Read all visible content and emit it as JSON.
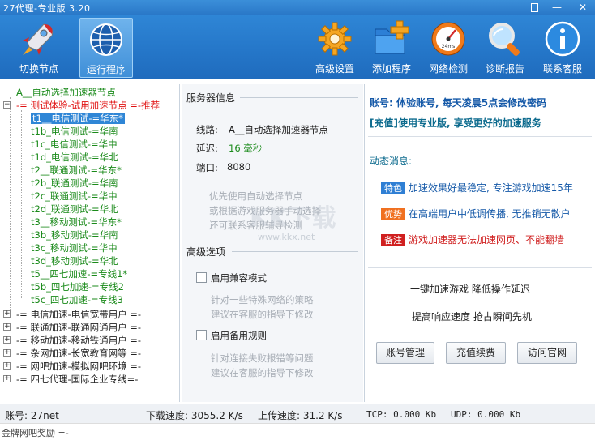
{
  "app": {
    "title": "27代理-专业版 3.20"
  },
  "toolbar": {
    "switch_node": "切换节点",
    "run_program": "运行程序",
    "advanced": "高级设置",
    "add_program": "添加程序",
    "net_check": "网络检测",
    "diag_report": "诊断报告",
    "contact": "联系客服",
    "gauge_text": "24ms"
  },
  "tree": {
    "auto": "A__自动选择加速器节点",
    "trial": "-= 测试体验-试用加速节点 =-推荐",
    "children": [
      "t1__电信测试-=华东*",
      "t1b_电信测试-=华南",
      "t1c_电信测试-=华中",
      "t1d_电信测试-=华北",
      "t2__联通测试-=华东*",
      "t2b_联通测试-=华南",
      "t2c_联通测试-=华中",
      "t2d_联通测试-=华北",
      "t3__移动测试-=华东*",
      "t3b_移动测试-=华南",
      "t3c_移动测试-=华中",
      "t3d_移动测试-=华北",
      "t5__四七加速-=专线1*",
      "t5b_四七加速-=专线2",
      "t5c_四七加速-=专线3"
    ],
    "groups": [
      "-= 电信加速-电信宽带用户 =-",
      "-= 联通加速-联通网通用户 =-",
      "-= 移动加速-移动铁通用户 =-",
      "-= 杂网加速-长宽教育网等 =-",
      "-= 网吧加速-模拟网吧环境 =-",
      "-= 四七代理-国际企业专线=-"
    ]
  },
  "server": {
    "section": "服务器信息",
    "line_label": "线路:",
    "line_value": "A__自动选择加速器节点",
    "delay_label": "延迟:",
    "delay_value": "16 毫秒",
    "port_label": "端口:",
    "port_value": "8080",
    "hint1": "优先使用自动选择节点",
    "hint2": "或根据游戏服务器手动选择",
    "hint3": "还可联系客服辅导检测"
  },
  "advanced": {
    "section": "高级选项",
    "compat_label": "启用兼容模式",
    "compat_hint1": "针对一些特殊网络的策略",
    "compat_hint2": "建议在客服的指导下修改",
    "backup_label": "启用备用规则",
    "backup_hint1": "针对连接失败报错等问题",
    "backup_hint2": "建议在客服的指导下修改"
  },
  "account": {
    "line": "账号: 体验账号, 每天凌晨5点会修改密码",
    "recharge": "[充值]使用专业版, 享受更好的加速服务"
  },
  "news": {
    "title": "动态消息:",
    "items": [
      {
        "tag": "特色",
        "text": "加速效果好最稳定, 专注游戏加速15年"
      },
      {
        "tag": "优势",
        "text": "在高端用户中低调传播, 无推销无散户"
      },
      {
        "tag": "备注",
        "text": "游戏加速器无法加速网页、不能翻墙"
      }
    ]
  },
  "slogan": {
    "line1": "一键加速游戏  降低操作延迟",
    "line2": "提高响应速度  抢占瞬间先机"
  },
  "buttons": {
    "account_mgmt": "账号管理",
    "recharge": "充值续费",
    "website": "访问官网"
  },
  "status": {
    "account": "账号: 27net",
    "download": "下载速度: 3055.2 K/s",
    "upload": "上传速度: 31.2 K/s",
    "tcp": "TCP: 0.000 Kb",
    "udp": "UDP: 0.000 Kb"
  },
  "bottom": {
    "text": "金牌网吧奖励 =-"
  },
  "watermark": {
    "main": "KK下载",
    "url": "www.kkx.net"
  },
  "colors": {
    "toolbar": "#2577c9",
    "accent_green": "#1a8a1a",
    "accent_red": "#e01010",
    "tag_blue": "#2f7fd4",
    "tag_orange": "#f07020",
    "tag_red": "#d02020"
  }
}
